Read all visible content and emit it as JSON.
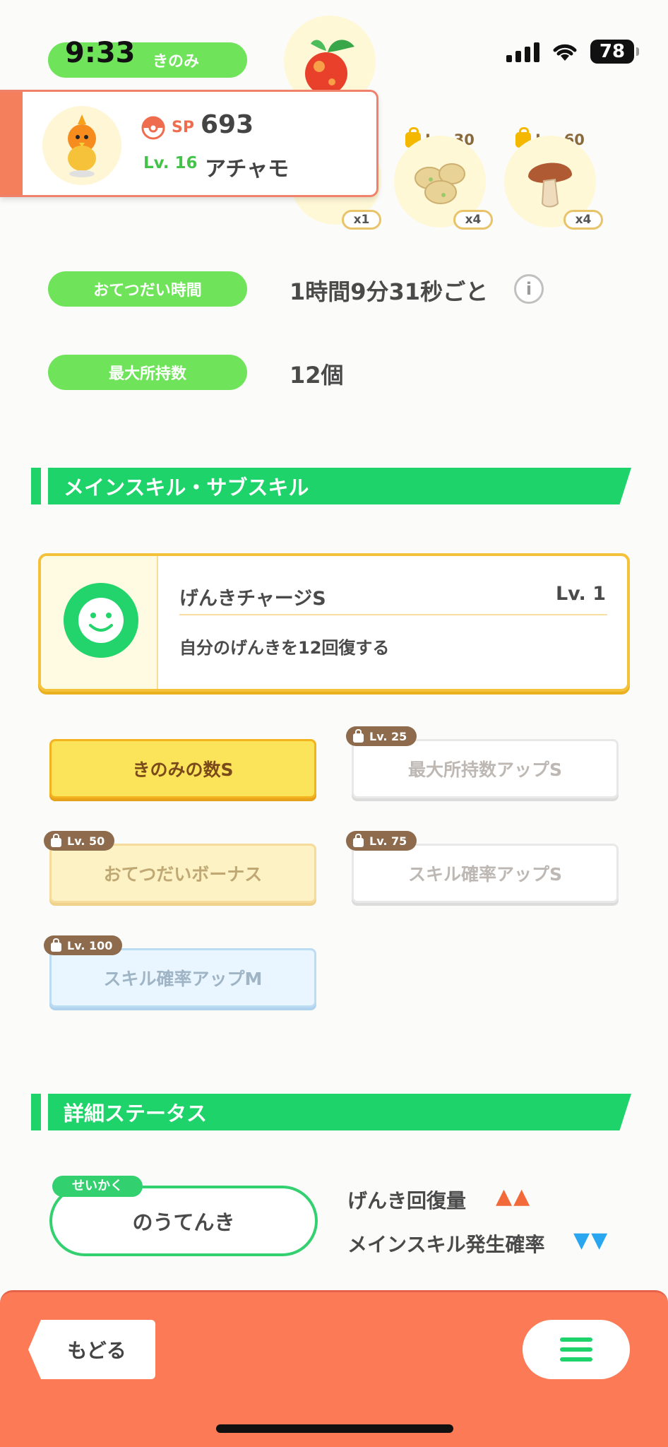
{
  "status_bar": {
    "time": "9:33",
    "battery": "78"
  },
  "header": {
    "top_pill": "きのみ",
    "sp_label": "SP",
    "sp_value": "693",
    "level": "Lv. 16",
    "name": "アチャモ"
  },
  "ingredients": [
    {
      "qty": "x1",
      "lock": ""
    },
    {
      "qty": "x4",
      "lock": "Lv. 30"
    },
    {
      "qty": "x4",
      "lock": "Lv. 60"
    }
  ],
  "info_rows": {
    "help_time_label": "おてつだい時間",
    "help_time_value": "1時間9分31秒ごと",
    "max_carry_label": "最大所持数",
    "max_carry_value": "12個"
  },
  "main_skill_section": {
    "title": "メインスキル・サブスキル",
    "skill_name": "げんきチャージS",
    "skill_level": "Lv. 1",
    "skill_desc": "自分のげんきを12回復する"
  },
  "sub_skills": [
    {
      "label": "きのみの数S",
      "lock": ""
    },
    {
      "label": "最大所持数アップS",
      "lock": "Lv. 25"
    },
    {
      "label": "おてつだいボーナス",
      "lock": "Lv. 50"
    },
    {
      "label": "スキル確率アップS",
      "lock": "Lv. 75"
    },
    {
      "label": "スキル確率アップM",
      "lock": "Lv. 100"
    }
  ],
  "detail_section": {
    "title": "詳細ステータス",
    "nature_tag": "せいかく",
    "nature": "のうてんき",
    "up_stat": "げんき回復量",
    "up_marks": "▲▲",
    "down_stat": "メインスキル発生確率",
    "down_marks": "▼▼"
  },
  "footer": {
    "back_label": "もどる"
  },
  "colors": {
    "accent_green": "#1ed36a",
    "pill_green": "#6fe35a",
    "footer_orange": "#fd7a56",
    "up_color": "#f26a3a",
    "down_color": "#2aa6f0"
  }
}
